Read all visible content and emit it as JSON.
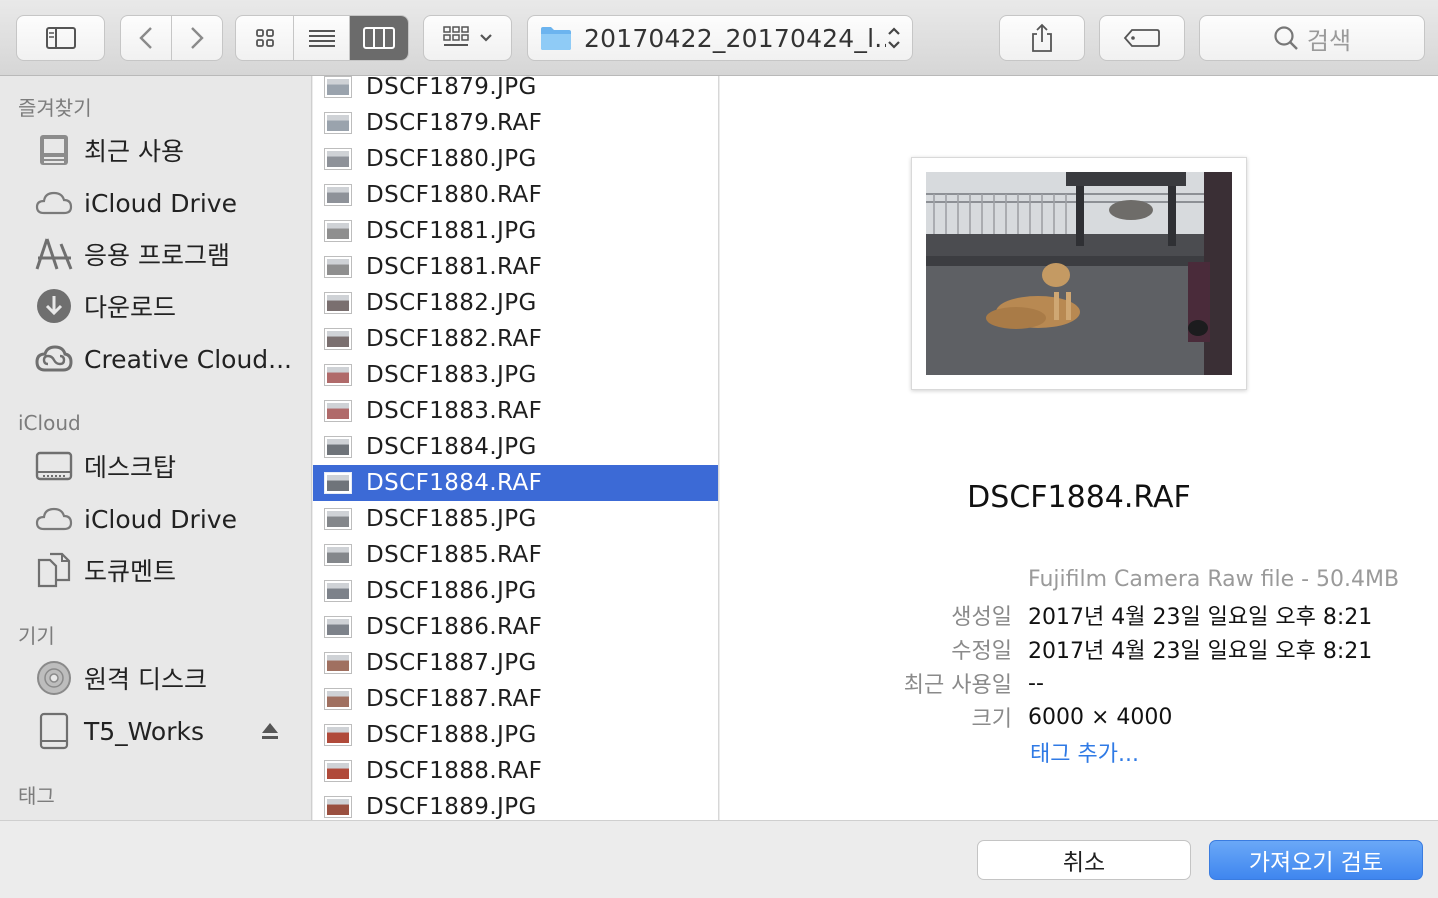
{
  "toolbar": {
    "path_folder": "20170422_20170424_l...",
    "search_placeholder": "검색"
  },
  "sidebar": {
    "sections": [
      {
        "title": "즐겨찾기",
        "items": [
          {
            "label": "최근 사용",
            "icon": "recents-icon"
          },
          {
            "label": "iCloud Drive",
            "icon": "cloud-icon"
          },
          {
            "label": "응용 프로그램",
            "icon": "applications-icon"
          },
          {
            "label": "다운로드",
            "icon": "download-icon"
          },
          {
            "label": "Creative Cloud...",
            "icon": "creative-cloud-icon"
          }
        ]
      },
      {
        "title": "iCloud",
        "items": [
          {
            "label": "데스크탑",
            "icon": "desktop-icon"
          },
          {
            "label": "iCloud Drive",
            "icon": "cloud-icon"
          },
          {
            "label": "도큐멘트",
            "icon": "document-icon"
          }
        ]
      },
      {
        "title": "기기",
        "items": [
          {
            "label": "원격 디스크",
            "icon": "disc-icon"
          },
          {
            "label": "T5_Works",
            "icon": "drive-icon"
          }
        ]
      },
      {
        "title": "태그",
        "items": []
      }
    ]
  },
  "files": [
    {
      "name": "DSCF1879.JPG",
      "tint": "#9aa3ad"
    },
    {
      "name": "DSCF1879.RAF",
      "tint": "#9aa3ad"
    },
    {
      "name": "DSCF1880.JPG",
      "tint": "#8e9299"
    },
    {
      "name": "DSCF1880.RAF",
      "tint": "#8e9299"
    },
    {
      "name": "DSCF1881.JPG",
      "tint": "#8f8f8f"
    },
    {
      "name": "DSCF1881.RAF",
      "tint": "#8f8f8f"
    },
    {
      "name": "DSCF1882.JPG",
      "tint": "#7a6f6f"
    },
    {
      "name": "DSCF1882.RAF",
      "tint": "#7a6f6f"
    },
    {
      "name": "DSCF1883.JPG",
      "tint": "#b06a6a"
    },
    {
      "name": "DSCF1883.RAF",
      "tint": "#b06a6a"
    },
    {
      "name": "DSCF1884.JPG",
      "tint": "#6f747a"
    },
    {
      "name": "DSCF1884.RAF",
      "tint": "#6f747a",
      "selected": true
    },
    {
      "name": "DSCF1885.JPG",
      "tint": "#84878b"
    },
    {
      "name": "DSCF1885.RAF",
      "tint": "#84878b"
    },
    {
      "name": "DSCF1886.JPG",
      "tint": "#7d828a"
    },
    {
      "name": "DSCF1886.RAF",
      "tint": "#7d828a"
    },
    {
      "name": "DSCF1887.JPG",
      "tint": "#a07060"
    },
    {
      "name": "DSCF1887.RAF",
      "tint": "#a07060"
    },
    {
      "name": "DSCF1888.JPG",
      "tint": "#b04a3a"
    },
    {
      "name": "DSCF1888.RAF",
      "tint": "#b04a3a"
    },
    {
      "name": "DSCF1889.JPG",
      "tint": "#9a5040"
    }
  ],
  "preview": {
    "file_name": "DSCF1884.RAF",
    "kind": "Fujifilm Camera Raw file - 50.4MB",
    "meta": [
      {
        "key": "생성일",
        "value": "2017년 4월 23일 일요일 오후 8:21"
      },
      {
        "key": "수정일",
        "value": "2017년 4월 23일 일요일 오후 8:21"
      },
      {
        "key": "최근 사용일",
        "value": "--"
      },
      {
        "key": "크기",
        "value": "6000 × 4000"
      }
    ],
    "add_tags": "태그 추가..."
  },
  "buttons": {
    "cancel": "취소",
    "primary": "가져오기 검토"
  },
  "colors": {
    "selection": "#3c6ad6",
    "link": "#2f7ae5",
    "primary_button": "#4a8df1"
  }
}
